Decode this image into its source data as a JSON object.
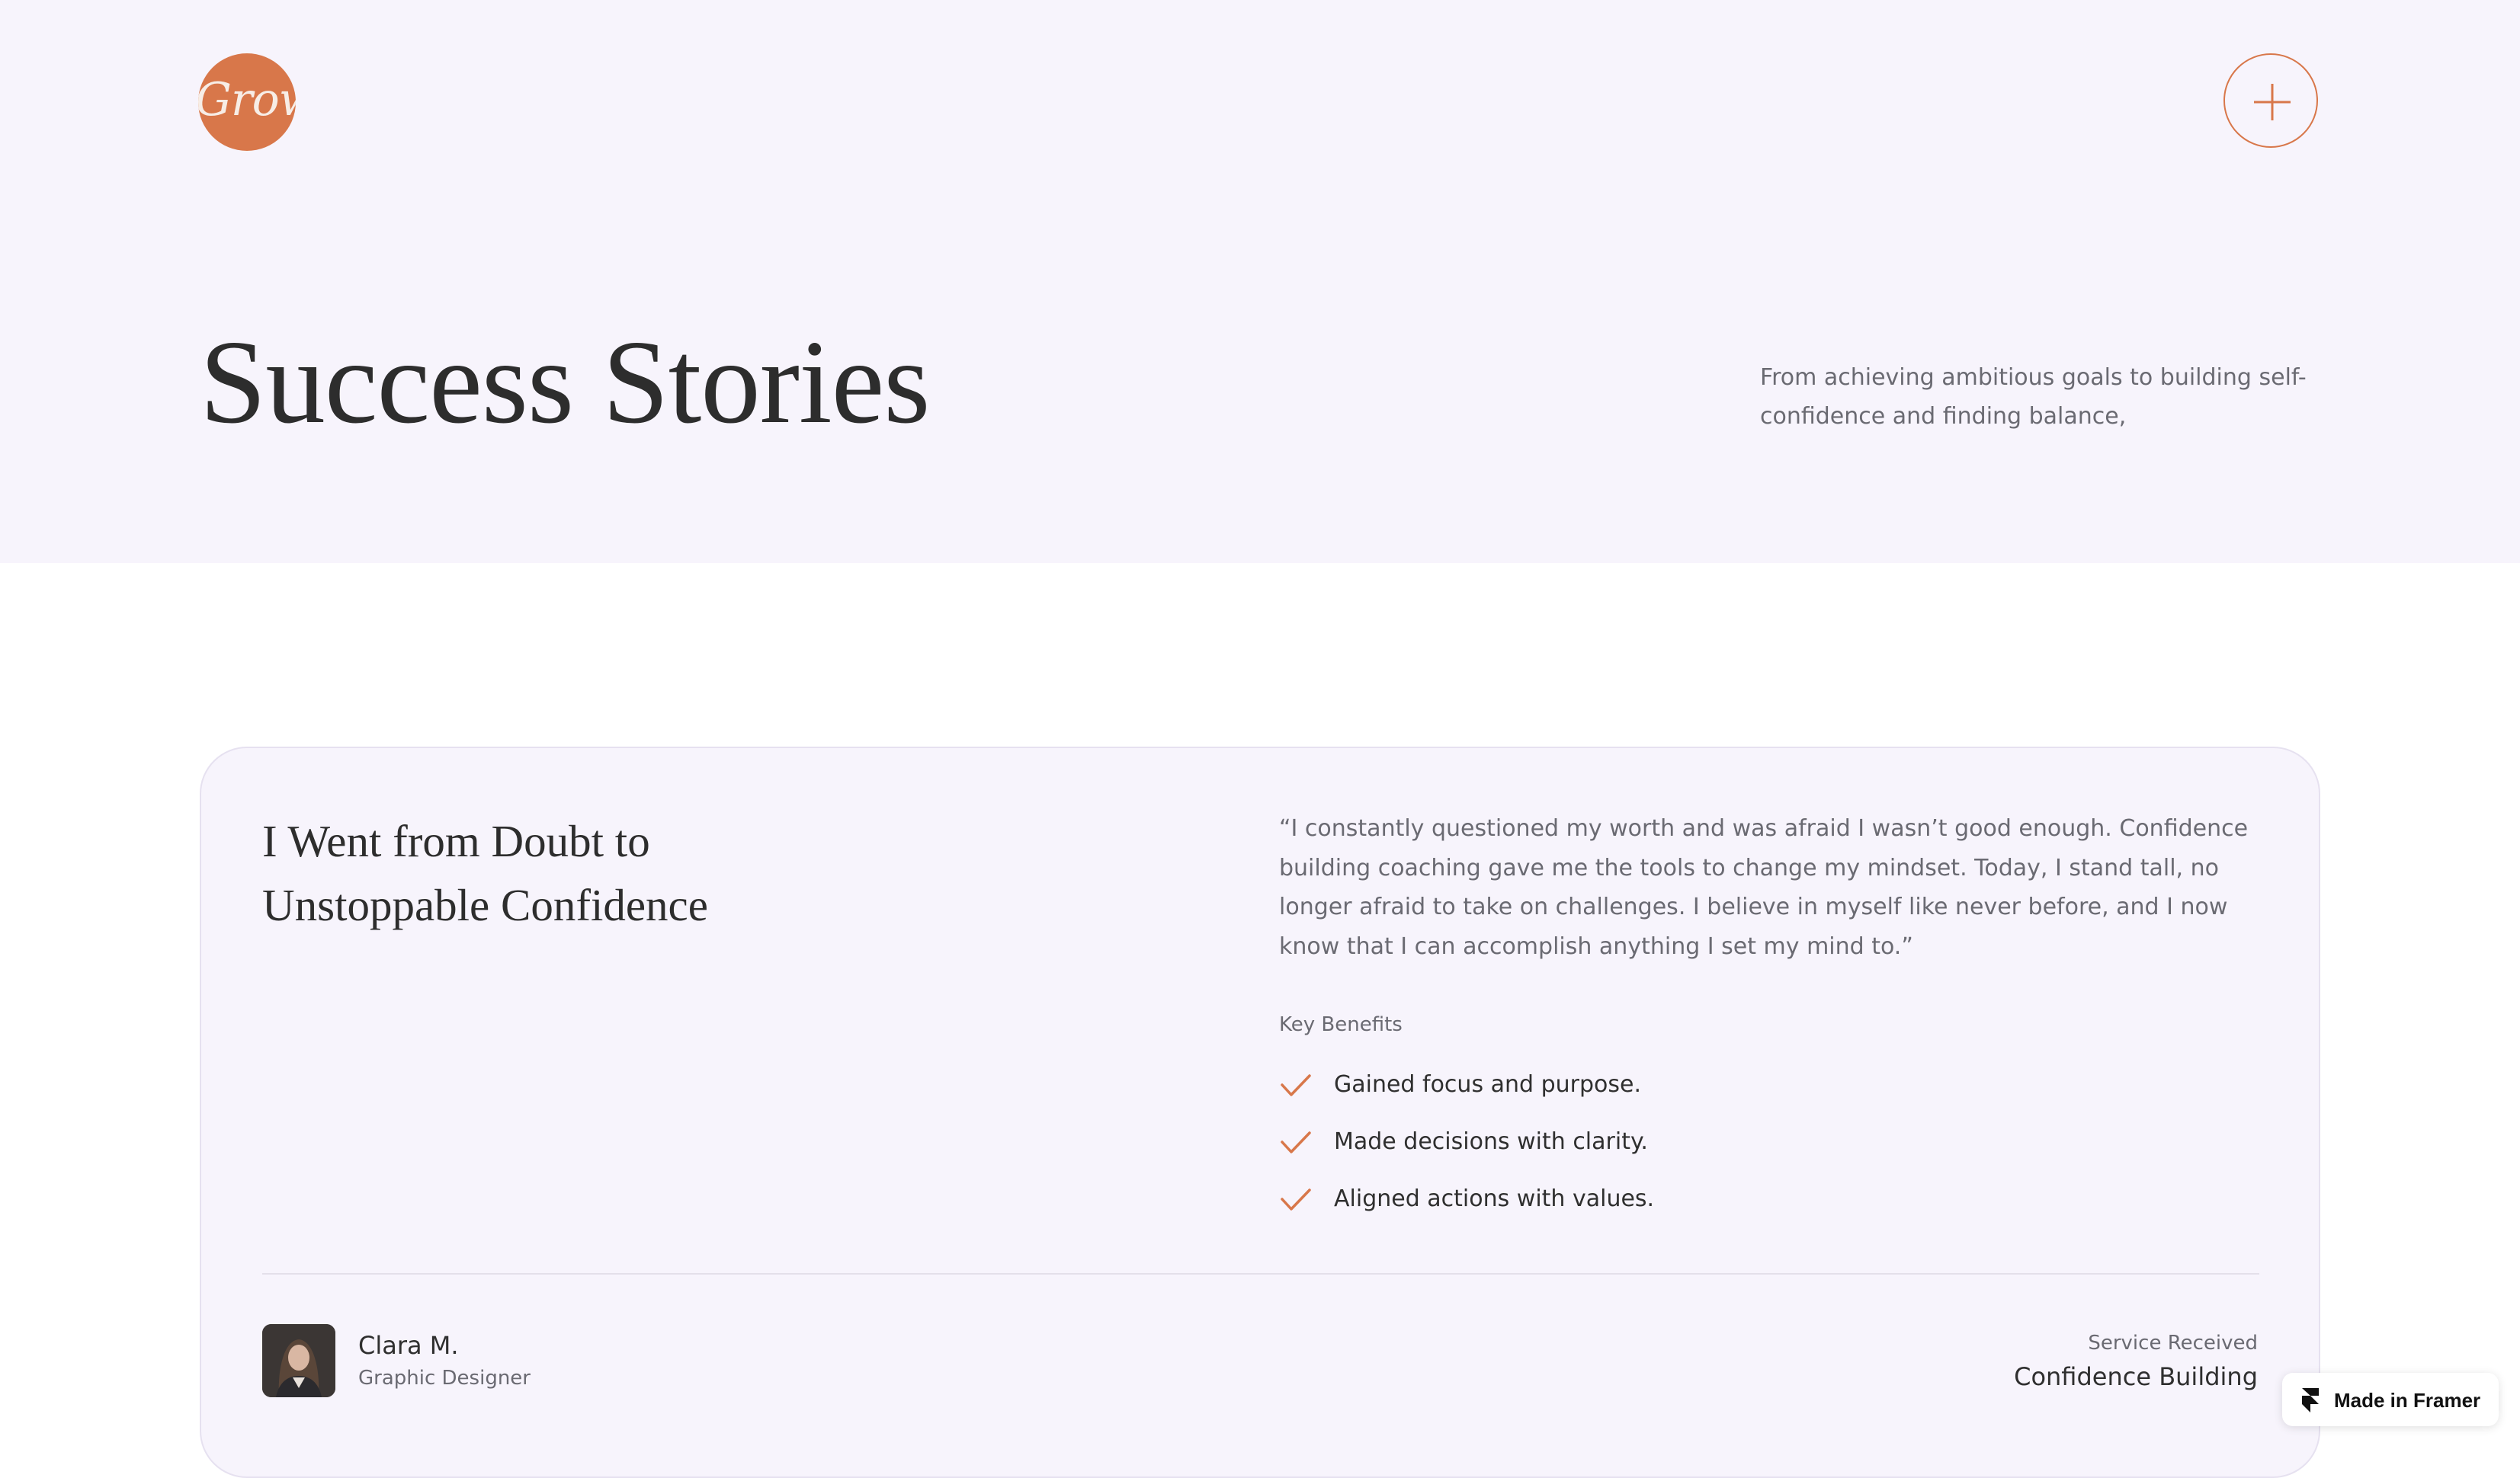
{
  "header": {
    "logo_text": "Grow",
    "logo_color": "#d8774a",
    "menu_icon": "plus-icon"
  },
  "hero": {
    "title": "Success Stories",
    "description": "From achieving ambitious goals to building self-confidence and finding balance,"
  },
  "story": {
    "title": "I Went from Doubt to Unstoppable Confidence",
    "quote": "“I constantly questioned my worth and was afraid I wasn’t good enough. Confidence building coaching gave me the tools to change my mindset. Today, I stand tall, no longer afraid to take on challenges. I believe in myself like never before, and I now know that I can accomplish anything I set my mind to.”",
    "benefits_label": "Key Benefits",
    "benefits": [
      "Gained focus and purpose.",
      "Made decisions with clarity.",
      "Aligned actions with values."
    ],
    "person": {
      "name": "Clara M.",
      "role": "Graphic Designer"
    },
    "service_label": "Service Received",
    "service_value": "Confidence Building"
  },
  "badge": {
    "label": "Made in Framer"
  },
  "colors": {
    "accent": "#d8774a",
    "hero_bg": "#f7f4fc",
    "text_dark": "#2d2d2d",
    "text_muted": "#6a6a72"
  }
}
